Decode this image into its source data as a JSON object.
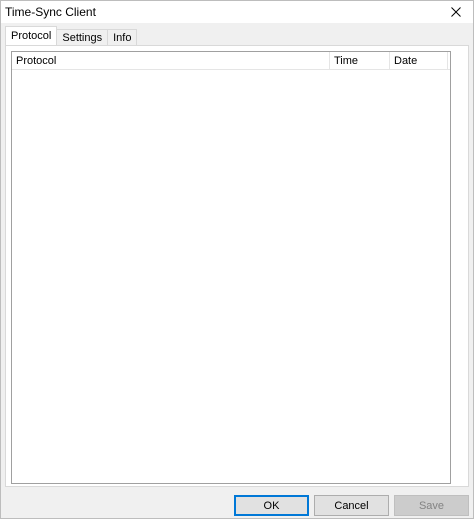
{
  "window": {
    "title": "Time-Sync Client"
  },
  "tabs": [
    {
      "label": "Protocol",
      "active": true
    },
    {
      "label": "Settings",
      "active": false
    },
    {
      "label": "Info",
      "active": false
    }
  ],
  "protocol_list": {
    "columns": [
      "Protocol",
      "Time",
      "Date"
    ],
    "rows": []
  },
  "buttons": {
    "ok": "OK",
    "cancel": "Cancel",
    "save": "Save"
  },
  "icons": {
    "close": "close-icon"
  },
  "colors": {
    "accent": "#0078d7",
    "window_bg": "#f0f0f0",
    "panel_bg": "#ffffff"
  }
}
